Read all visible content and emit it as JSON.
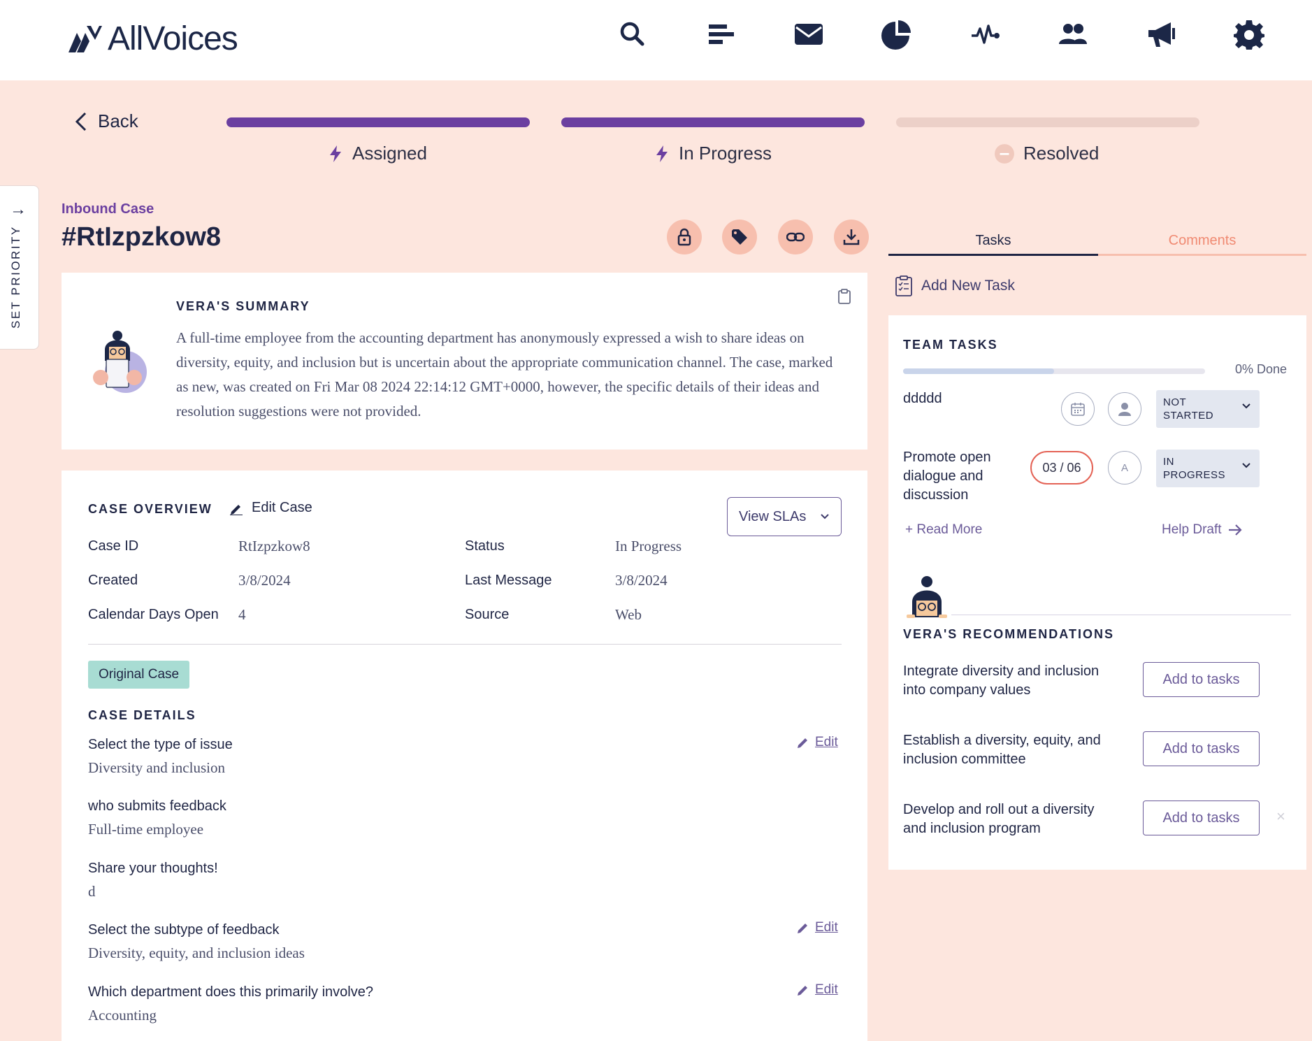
{
  "app": {
    "brand": "AllVoices",
    "colors": {
      "accent": "#6b3fa0",
      "navy": "#1c2747",
      "peach_bg": "#fde6de",
      "icon_pill": "#f7bfae",
      "alert_red": "#e46255"
    }
  },
  "nav": {
    "icons": [
      "search-icon",
      "list-icon",
      "mail-icon",
      "pie-chart-icon",
      "activity-icon",
      "team-icon",
      "megaphone-icon",
      "settings-icon"
    ]
  },
  "back_label": "Back",
  "stages": [
    {
      "label": "Assigned",
      "state": "complete",
      "icon": "bolt-icon"
    },
    {
      "label": "In Progress",
      "state": "complete",
      "icon": "bolt-icon"
    },
    {
      "label": "Resolved",
      "state": "pending",
      "icon": "minus-circle-icon"
    }
  ],
  "priority_tab": {
    "label": "SET PRIORITY",
    "icon": "arrow-right-icon"
  },
  "case": {
    "type": "Inbound Case",
    "title": "#RtIzpzkow8",
    "actions": [
      "lock-icon",
      "tag-icon",
      "link-icon",
      "download-icon"
    ]
  },
  "summary": {
    "heading": "VERA'S SUMMARY",
    "text": "A full-time employee from the accounting department has anonymously expressed a wish to share ideas on diversity, equity, and inclusion but is uncertain about the appropriate communication channel. The case, marked as new, was created on Fri Mar 08 2024 22:14:12 GMT+0000, however, the specific details of their ideas and resolution suggestions were not provided."
  },
  "overview": {
    "heading": "CASE OVERVIEW",
    "edit_case": "Edit Case",
    "view_slas": "View SLAs",
    "fields": {
      "case_id_label": "Case ID",
      "case_id": "RtIzpzkow8",
      "created_label": "Created",
      "created": "3/8/2024",
      "days_open_label": "Calendar Days Open",
      "days_open": "4",
      "status_label": "Status",
      "status": "In Progress",
      "last_message_label": "Last Message",
      "last_message": "3/8/2024",
      "source_label": "Source",
      "source": "Web"
    },
    "original_badge": "Original Case",
    "details_heading": "CASE DETAILS",
    "edit_label": "Edit",
    "details": [
      {
        "q": "Select the type of issue",
        "a": "Diversity and inclusion",
        "editable": true
      },
      {
        "q": "who submits feedback",
        "a": "Full-time employee",
        "editable": false
      },
      {
        "q": "Share your thoughts!",
        "a": "d",
        "editable": false
      },
      {
        "q": "Select the subtype of feedback",
        "a": "Diversity, equity, and inclusion ideas",
        "editable": true
      },
      {
        "q": "Which department does this primarily involve?",
        "a": "Accounting",
        "editable": true
      }
    ]
  },
  "right_panel": {
    "tabs": [
      {
        "label": "Tasks",
        "active": true
      },
      {
        "label": "Comments",
        "active": false
      }
    ],
    "add_task": "Add New Task",
    "team_tasks": {
      "heading": "TEAM TASKS",
      "progress_percent": 0,
      "done_label": "0% Done",
      "tasks": [
        {
          "name": "ddddd",
          "date": "",
          "assignee": "",
          "status_line1": "NOT",
          "status_line2": "STARTED"
        },
        {
          "name_line1": "Promote open",
          "name_line2": "dialogue and",
          "name_line3": "discussion",
          "date": "03 / 06",
          "assignee": "A",
          "status_line1": "IN",
          "status_line2": "PROGRESS"
        }
      ],
      "read_more": "+ Read More",
      "help_draft": "Help Draft"
    },
    "recommendations": {
      "heading": "VERA'S RECOMMENDATIONS",
      "add_label": "Add to tasks",
      "items": [
        {
          "line1": "Integrate diversity and inclusion",
          "line2": "into company values"
        },
        {
          "line1": "Establish a diversity, equity, and",
          "line2": "inclusion committee"
        },
        {
          "line1": "Develop and roll out a diversity",
          "line2": "and inclusion program"
        }
      ],
      "dismiss": "×"
    }
  }
}
